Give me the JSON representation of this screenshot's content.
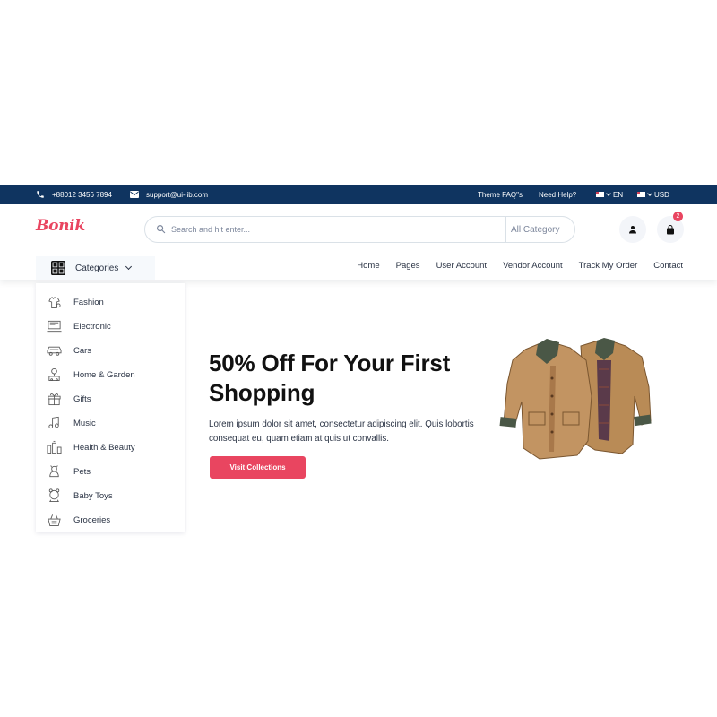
{
  "topbar": {
    "phone": "+88012 3456 7894",
    "email": "support@ui-lib.com",
    "faq": "Theme FAQ\"s",
    "help": "Need Help?",
    "language": "EN",
    "currency": "USD",
    "background": "#0f3460"
  },
  "header": {
    "logo": "Bonik",
    "search_placeholder": "Search and hit enter...",
    "category_select": "All Category",
    "cart_count": "2",
    "accent": "#e94560"
  },
  "navbar": {
    "categories_label": "Categories",
    "links": [
      "Home",
      "Pages",
      "User Account",
      "Vendor Account",
      "Track My Order",
      "Contact"
    ]
  },
  "categories": [
    {
      "label": "Fashion",
      "icon": "dress-icon"
    },
    {
      "label": "Electronic",
      "icon": "laptop-icon"
    },
    {
      "label": "Cars",
      "icon": "car-icon"
    },
    {
      "label": "Home & Garden",
      "icon": "garden-icon"
    },
    {
      "label": "Gifts",
      "icon": "gift-icon"
    },
    {
      "label": "Music",
      "icon": "music-icon"
    },
    {
      "label": "Health & Beauty",
      "icon": "health-icon"
    },
    {
      "label": "Pets",
      "icon": "pet-icon"
    },
    {
      "label": "Baby Toys",
      "icon": "toy-icon"
    },
    {
      "label": "Groceries",
      "icon": "basket-icon"
    }
  ],
  "hero": {
    "title": "50% Off For Your First Shopping",
    "text": "Lorem ipsum dolor sit amet, consectetur adipiscing elit. Quis lobortis consequat eu, quam etiam at quis ut convallis.",
    "button": "Visit Collections",
    "image": "jackets"
  }
}
